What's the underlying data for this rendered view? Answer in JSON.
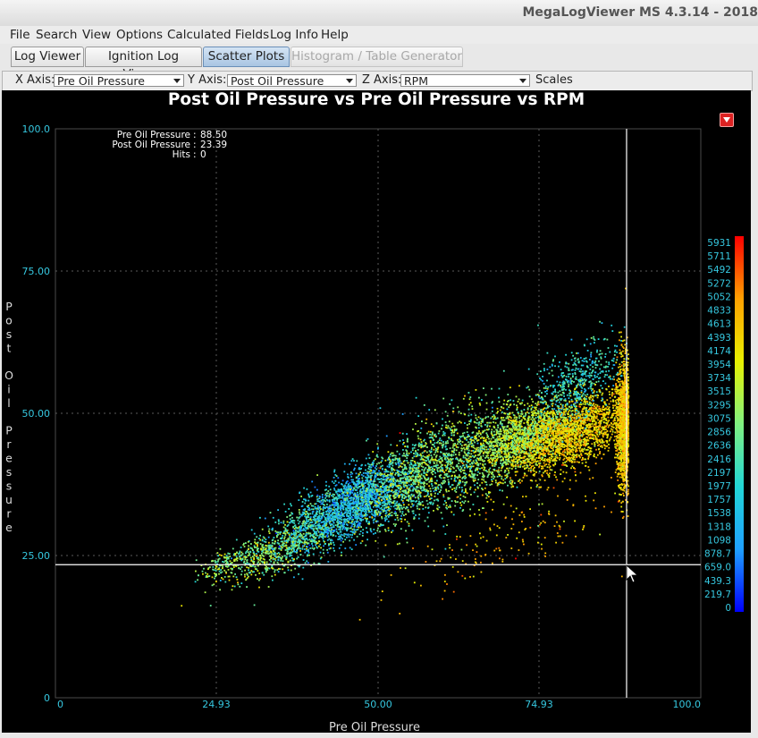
{
  "window": {
    "title": "MegaLogViewer MS 4.3.14 - 2018"
  },
  "menu": [
    {
      "name": "menu-file",
      "text": "File"
    },
    {
      "name": "menu-search",
      "text": "Search"
    },
    {
      "name": "menu-view",
      "text": "View"
    },
    {
      "name": "menu-options",
      "text": "Options"
    },
    {
      "name": "menu-calculated-fields",
      "text": "Calculated Fields"
    },
    {
      "name": "menu-log-info",
      "text": "Log Info"
    },
    {
      "name": "menu-help",
      "text": "Help"
    }
  ],
  "tabs": [
    {
      "label": "Log Viewer",
      "state": "normal"
    },
    {
      "label": "Ignition Log Viewer",
      "state": "normal"
    },
    {
      "label": "Scatter Plots",
      "state": "active"
    },
    {
      "label": "Histogram / Table Generator",
      "state": "disabled"
    }
  ],
  "axes_selector": {
    "x_label": "X Axis:",
    "x_value": "Pre Oil Pressure",
    "y_label": "Y Axis:",
    "y_value": "Post Oil Pressure",
    "z_label": "Z Axis:",
    "z_value": "RPM",
    "scales_label": "Scales"
  },
  "chart_data": {
    "type": "scatter",
    "title": "Post Oil Pressure vs Pre Oil Pressure vs RPM",
    "xlabel": "Pre Oil Pressure",
    "ylabel": "Post Oil Pressure",
    "zlabel": "RPM",
    "xlim": [
      0,
      100
    ],
    "ylim": [
      0,
      100
    ],
    "x_ticks": [
      "0",
      "24.93",
      "50.00",
      "74.93",
      "100.0"
    ],
    "x_tick_values": [
      0,
      24.93,
      50.0,
      74.93,
      100.0
    ],
    "y_ticks": [
      "0",
      "25.00",
      "50.00",
      "75.00",
      "100.0"
    ],
    "y_tick_values": [
      0,
      25,
      50,
      75,
      100
    ],
    "grid": true,
    "cursor": {
      "x": 88.5,
      "y": 23.39
    },
    "readout": [
      {
        "label": "Pre Oil Pressure",
        "value": "88.50"
      },
      {
        "label": "Post Oil Pressure",
        "value": "23.39"
      },
      {
        "label": "Hits",
        "value": "0"
      }
    ],
    "zscale": {
      "labels": [
        "5931",
        "5711",
        "5492",
        "5272",
        "5052",
        "4833",
        "4613",
        "4393",
        "4174",
        "3954",
        "3734",
        "3515",
        "3295",
        "3075",
        "2856",
        "2636",
        "2416",
        "2197",
        "1977",
        "1757",
        "1538",
        "1318",
        "1098",
        "878.7",
        "659.0",
        "439.3",
        "219.7",
        "0"
      ],
      "min": 0,
      "max": 5931,
      "colors": [
        "#0000ff",
        "#1fa0ff",
        "#22d6d6",
        "#80f080",
        "#e8f000",
        "#ffa000",
        "#ff0000"
      ]
    },
    "clusters": [
      {
        "x": 27,
        "y": 24,
        "z": 3000,
        "count": 170,
        "sx": 2.5,
        "sy": 1.2,
        "zsd": 600
      },
      {
        "x": 33,
        "y": 25.5,
        "z": 3200,
        "count": 420,
        "sx": 4,
        "sy": 2,
        "zsd": 600
      },
      {
        "x": 40,
        "y": 30,
        "z": 2200,
        "count": 850,
        "sx": 4,
        "sy": 2.6,
        "zsd": 700
      },
      {
        "x": 47,
        "y": 35,
        "z": 1500,
        "count": 1300,
        "sx": 3.5,
        "sy": 2.8,
        "zsd": 550
      },
      {
        "x": 54,
        "y": 38,
        "z": 2800,
        "count": 900,
        "sx": 4,
        "sy": 3.5,
        "zsd": 700
      },
      {
        "x": 62,
        "y": 42,
        "z": 3000,
        "count": 950,
        "sx": 5,
        "sy": 4.5,
        "zsd": 750
      },
      {
        "x": 72,
        "y": 45.5,
        "z": 3400,
        "count": 1500,
        "sx": 4,
        "sy": 3,
        "zsd": 500
      },
      {
        "x": 80,
        "y": 46.5,
        "z": 4300,
        "count": 1900,
        "sx": 4.2,
        "sy": 3,
        "zsd": 450
      },
      {
        "x": 81,
        "y": 56,
        "z": 2100,
        "count": 500,
        "sx": 3.2,
        "sy": 3.5,
        "zsd": 500
      },
      {
        "x": 88,
        "y": 48,
        "z": 4400,
        "count": 1300,
        "sx": 0.6,
        "sy": 5.5,
        "zsd": 380
      },
      {
        "x": 70,
        "y": 28,
        "z": 4600,
        "count": 160,
        "sx": 9,
        "sy": 3.5,
        "zsd": 500
      }
    ]
  }
}
